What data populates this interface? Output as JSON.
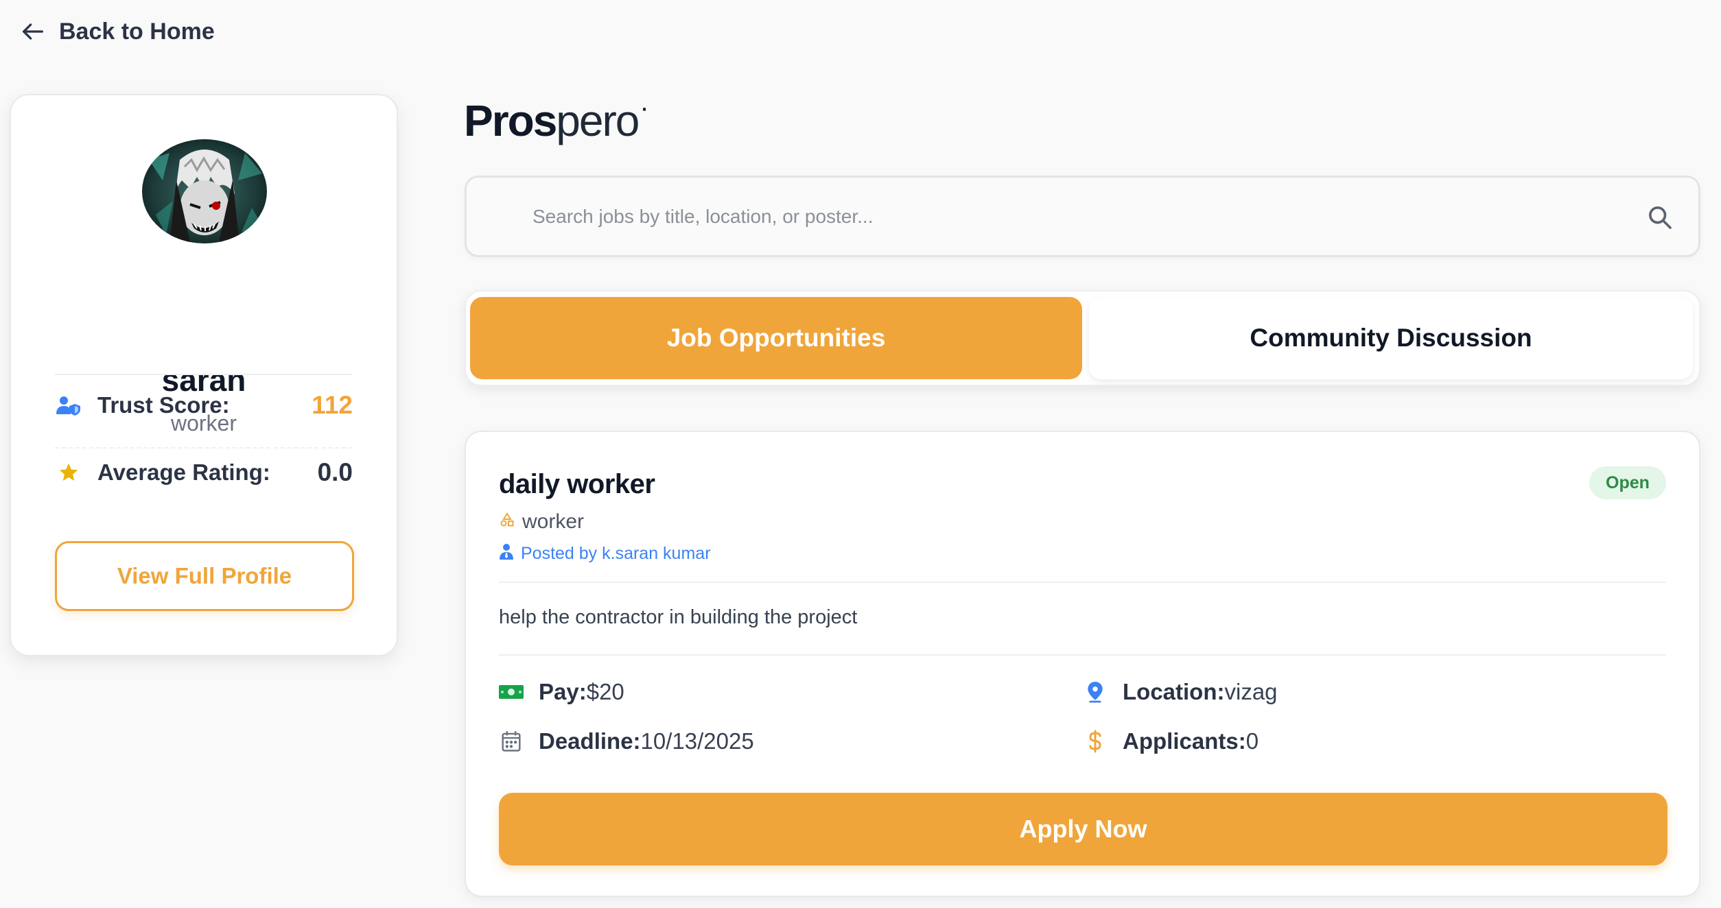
{
  "nav": {
    "back_label": "Back to Home"
  },
  "profile": {
    "name": "saran",
    "role": "worker",
    "trust_label": "Trust Score:",
    "trust_value": "112",
    "rating_label": "Average Rating:",
    "rating_value": "0.0",
    "view_profile_label": "View Full Profile"
  },
  "logo": {
    "bold_part": "Pros",
    "thin_part": "pero",
    "dot": "·"
  },
  "search": {
    "placeholder": "Search jobs by title, location, or poster...",
    "value": ""
  },
  "tabs": [
    {
      "label": "Job Opportunities",
      "active": true
    },
    {
      "label": "Community Discussion",
      "active": false
    }
  ],
  "job": {
    "title": "daily worker",
    "status": "Open",
    "category": "worker",
    "poster": "Posted by k.saran kumar",
    "description": "help the contractor in building the project",
    "pay_label": "Pay:",
    "pay_value": "$20",
    "location_label": "Location:",
    "location_value": "vizag",
    "deadline_label": "Deadline:",
    "deadline_value": "10/13/2025",
    "applicants_label": "Applicants:",
    "applicants_value": "0",
    "apply_label": "Apply Now"
  },
  "colors": {
    "accent": "#f0a53b",
    "status_bg": "#e3f6e7",
    "status_text": "#2d8a47",
    "link_blue": "#3b82f6"
  }
}
